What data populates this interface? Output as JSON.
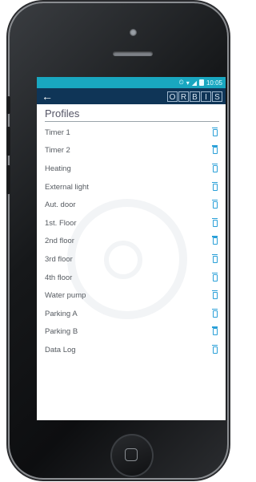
{
  "status_bar": {
    "time": "10:05"
  },
  "app_bar": {
    "back_icon": "←",
    "logo_letters": [
      "O",
      "R",
      "B",
      "I",
      "S"
    ]
  },
  "page": {
    "title": "Profiles"
  },
  "profiles": [
    "Timer 1",
    "Timer 2",
    "Heating",
    "External light",
    "Aut. door",
    "1st. Floor",
    "2nd floor",
    "3rd floor",
    "4th floor",
    "Water pump",
    "Parking A",
    "Parking B",
    "Data Log"
  ],
  "colors": {
    "status_bar": "#19a7c0",
    "app_bar": "#0f3557",
    "delete_icon": "#2aa0d8"
  }
}
